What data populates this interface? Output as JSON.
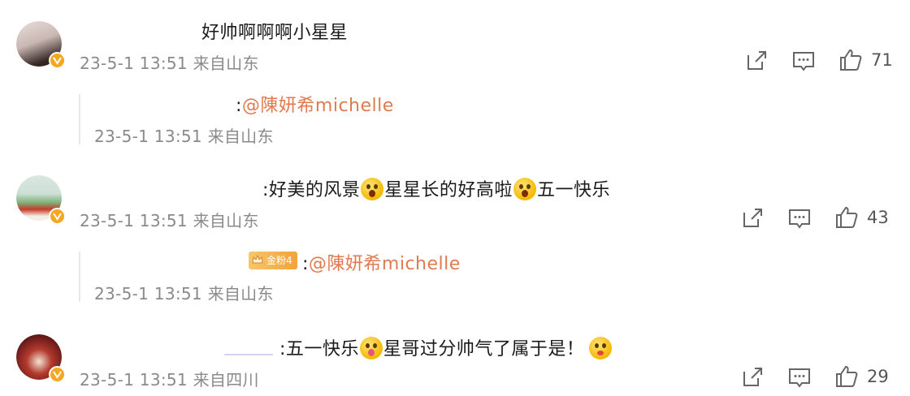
{
  "colors": {
    "mention": "#e07a4f",
    "meta": "#8a8a8a",
    "verified_badge": "#f5a623",
    "fan_badge": "#f3a33a"
  },
  "comments": [
    {
      "text": "好帅啊啊啊小星星",
      "time": "23-5-1 13:51 来自山东",
      "likes": "71",
      "reply": {
        "prefix": ":",
        "mention": "@陳妍希michelle",
        "time": "23-5-1 13:51 来自山东"
      }
    },
    {
      "text_parts": [
        ":好美的风景",
        "星星长的好高啦",
        "五一快乐"
      ],
      "time": "23-5-1 13:51 来自山东",
      "likes": "43",
      "reply": {
        "badge": "金粉4",
        "prefix": ":",
        "mention": "@陳妍希michelle",
        "time": "23-5-1 13:51 来自山东"
      }
    },
    {
      "text_parts": [
        ":五一快乐",
        "星哥过分帅气了属于是！"
      ],
      "time": "23-5-1 13:51 来自四川",
      "likes": "29"
    }
  ],
  "icons": {
    "share": "share-icon",
    "comment": "comment-icon",
    "like": "like-icon",
    "verified": "verified-badge-icon"
  }
}
